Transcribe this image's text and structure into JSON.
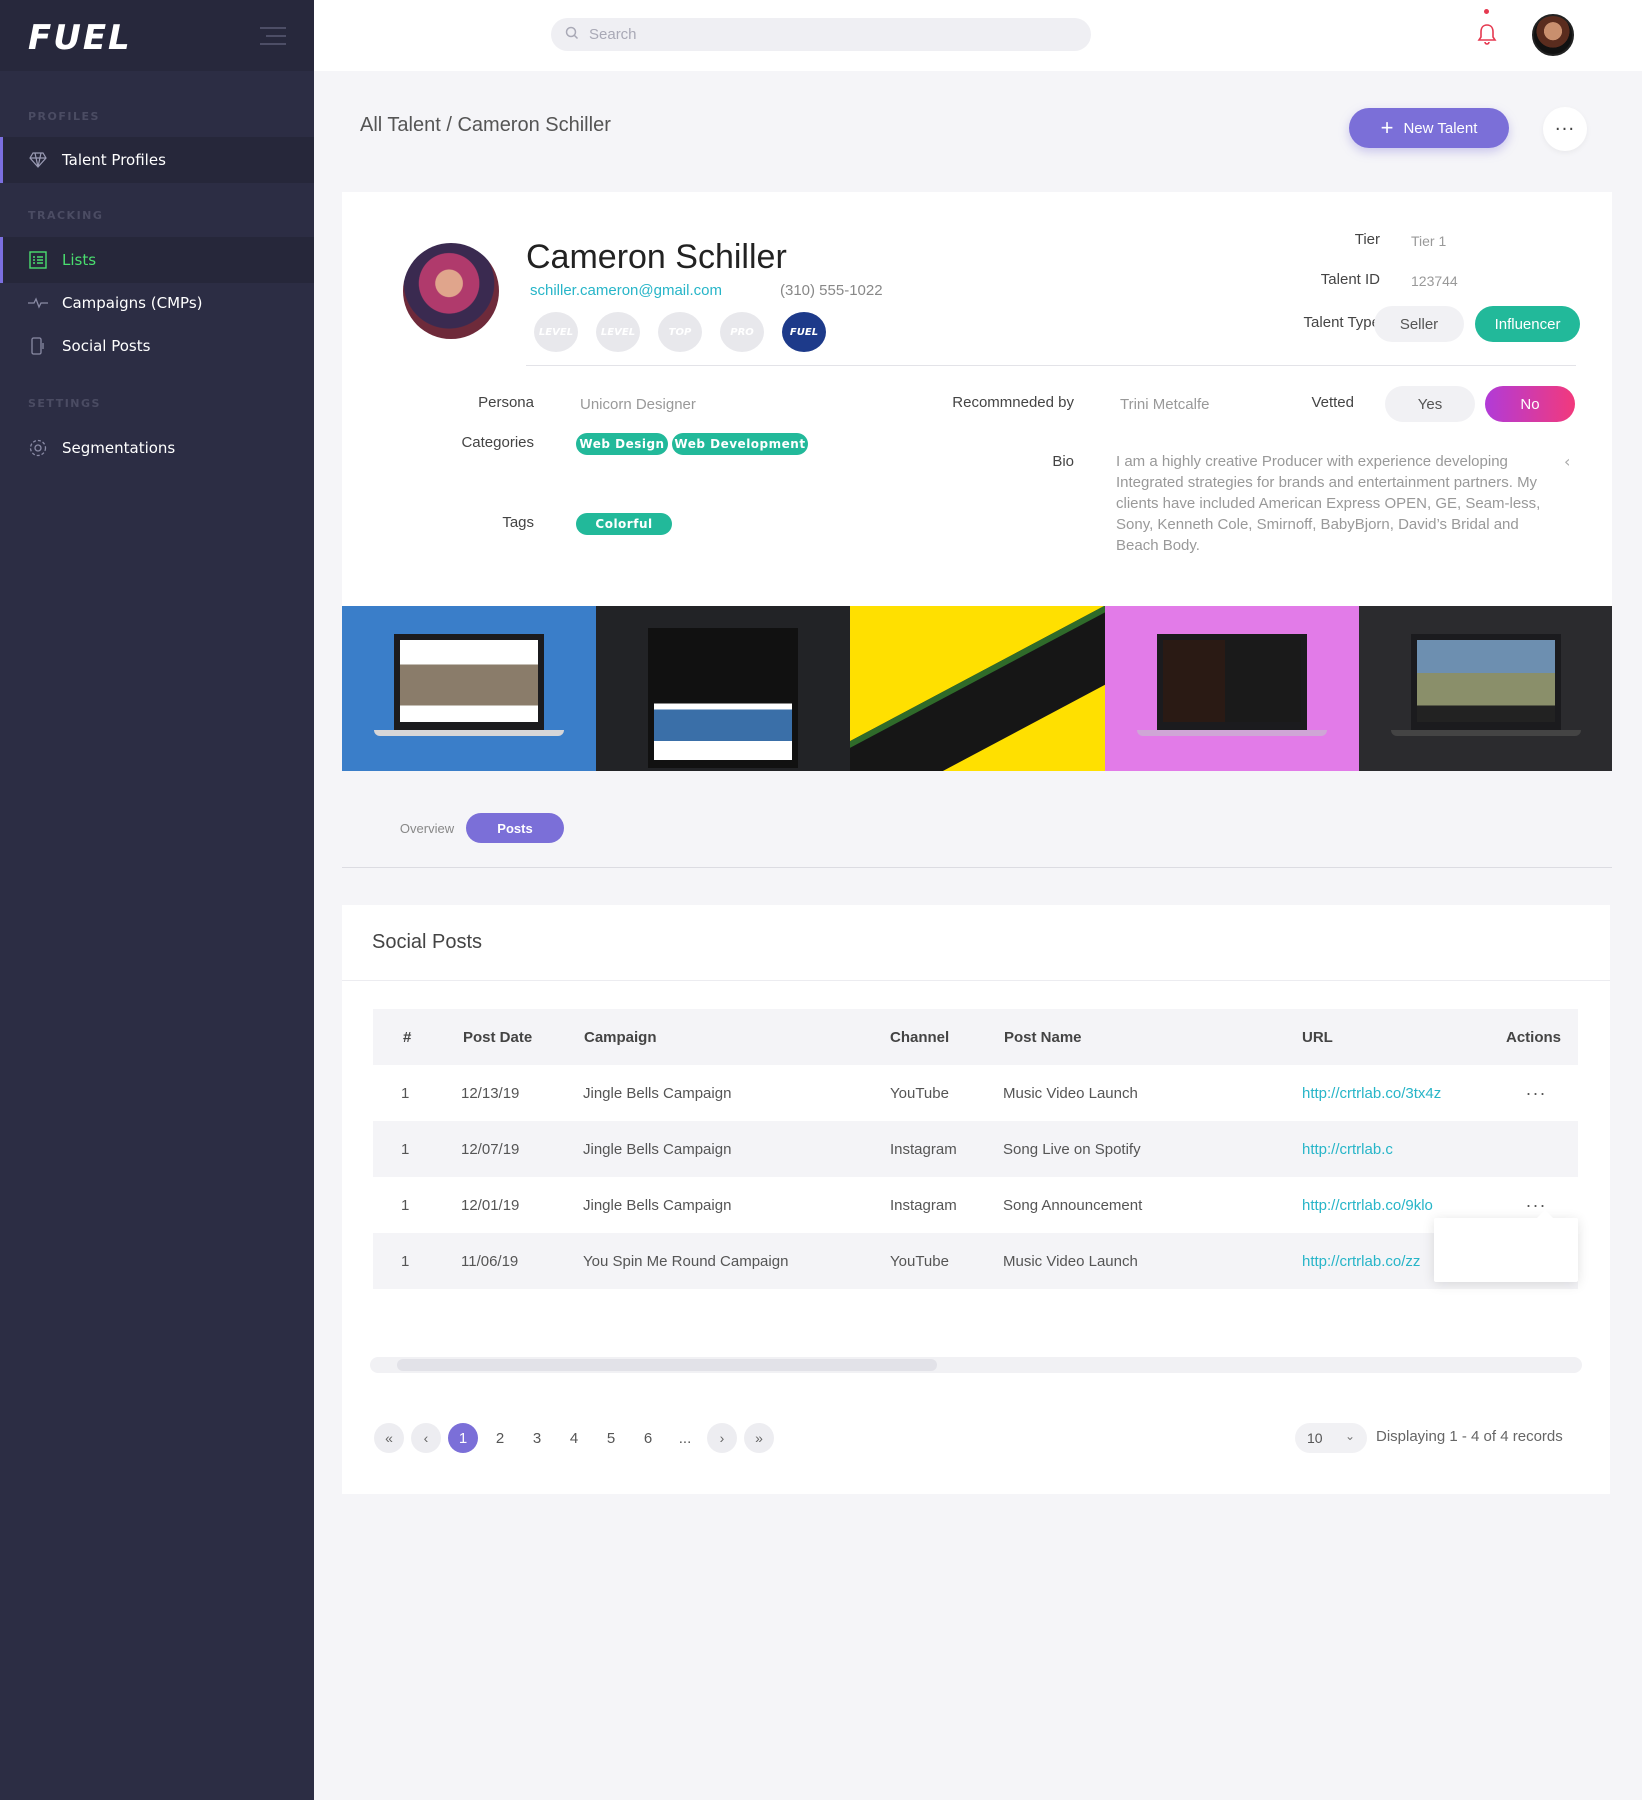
{
  "brand": {
    "logo": "FUEL"
  },
  "sidebar": {
    "sections": [
      {
        "label": "PROFILES",
        "items": [
          {
            "label": "Talent Profiles",
            "icon": "diamond-icon"
          }
        ]
      },
      {
        "label": "TRACKING",
        "items": [
          {
            "label": "Lists",
            "icon": "list-icon"
          },
          {
            "label": "Campaigns (CMPs)",
            "icon": "pulse-icon"
          },
          {
            "label": "Social Posts",
            "icon": "phone-icon"
          }
        ]
      },
      {
        "label": "SETTINGS",
        "items": [
          {
            "label": "Segmentations",
            "icon": "gear-icon"
          }
        ]
      }
    ]
  },
  "topbar": {
    "search_placeholder": "Search"
  },
  "header": {
    "breadcrumb": "All Talent / Cameron Schiller",
    "new_button": "New Talent",
    "more_button": "···"
  },
  "profile": {
    "name": "Cameron Schiller",
    "email": "schiller.cameron@gmail.com",
    "phone": "(310) 555-1022",
    "badges": [
      "LEVEL",
      "LEVEL",
      "TOP",
      "PRO",
      "FUEL"
    ],
    "tier_label": "Tier",
    "tier_value": "Tier 1",
    "talent_id_label": "Talent ID",
    "talent_id_value": "123744",
    "talent_type_label": "Talent Type",
    "talent_type_options": [
      "Seller",
      "Influencer"
    ],
    "talent_type_selected": "Influencer",
    "persona_label": "Persona",
    "persona_value": "Unicorn Designer",
    "recommended_label": "Recommneded by",
    "recommended_value": "Trini Metcalfe",
    "vetted_label": "Vetted",
    "vetted_options": [
      "Yes",
      "No"
    ],
    "vetted_selected": "No",
    "categories_label": "Categories",
    "categories": [
      "Web Design",
      "Web Development"
    ],
    "tags_label": "Tags",
    "tags": [
      "Colorful"
    ],
    "bio_label": "Bio",
    "bio": "I am a highly creative Producer with experience developing Integrated strategies for brands and entertainment partners. My clients have included American Express OPEN, GE, Seam-less, Sony, Kenneth Cole, Smirnoff, BabyBjorn, David’s Bridal and Beach Body."
  },
  "tabs": {
    "overview": "Overview",
    "posts": "Posts"
  },
  "social_posts": {
    "title": "Social Posts",
    "columns": [
      "#",
      "Post Date",
      "Campaign",
      "Channel",
      "Post Name",
      "URL",
      "Actions"
    ],
    "rows": [
      [
        "1",
        "12/13/19",
        "Jingle Bells Campaign",
        "YouTube",
        "Music Video Launch",
        "http://crtrlab.co/3tx4z",
        "..."
      ],
      [
        "1",
        "12/07/19",
        "Jingle Bells Campaign",
        "Instagram",
        "Song Live on Spotify",
        "http://crtrlab.c",
        ""
      ],
      [
        "1",
        "12/01/19",
        "Jingle Bells Campaign",
        "Instagram",
        "Song Announcement",
        "http://crtrlab.co/9klo",
        "..."
      ],
      [
        "1",
        "11/06/19",
        "You Spin Me Round Campaign",
        "YouTube",
        "Music Video Launch",
        "http://crtrlab.co/zz",
        "..."
      ]
    ]
  },
  "pagination": {
    "first": "«",
    "prev": "‹",
    "next": "›",
    "last": "»",
    "pages": [
      "1",
      "2",
      "3",
      "4",
      "5",
      "6",
      "..."
    ],
    "current": "1",
    "per_page": "10",
    "records": "Displaying 1 - 4 of 4 records"
  },
  "colors": {
    "accent": "#7b6fd8",
    "teal": "#22b99a",
    "link": "#27b5c8",
    "sidebar": "#2c2d44"
  }
}
